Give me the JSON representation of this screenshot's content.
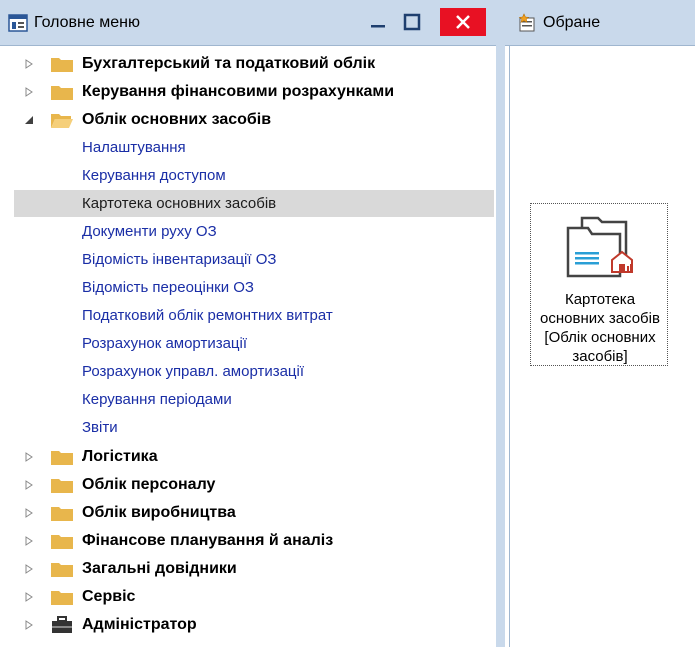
{
  "main_menu": {
    "title": "Головне меню",
    "categories_top": [
      {
        "label": "Бухгалтерський та податковий облік",
        "expanded": false
      },
      {
        "label": "Керування фінансовими розрахунками",
        "expanded": false
      },
      {
        "label": "Облік основних засобів",
        "expanded": true
      }
    ],
    "subitems": [
      {
        "label": "Налаштування",
        "selected": false
      },
      {
        "label": "Керування доступом",
        "selected": false
      },
      {
        "label": "Картотека основних засобів",
        "selected": true
      },
      {
        "label": "Документи руху ОЗ",
        "selected": false
      },
      {
        "label": "Відомість інвентаризації ОЗ",
        "selected": false
      },
      {
        "label": "Відомість переоцінки ОЗ",
        "selected": false
      },
      {
        "label": "Податковий облік ремонтних витрат",
        "selected": false
      },
      {
        "label": "Розрахунок амортизації",
        "selected": false
      },
      {
        "label": "Розрахунок управл. амортизації",
        "selected": false
      },
      {
        "label": "Керування періодами",
        "selected": false
      },
      {
        "label": "Звіти",
        "selected": false
      }
    ],
    "categories_bottom": [
      {
        "label": "Логістика",
        "icon": "folder-icon"
      },
      {
        "label": "Облік персоналу",
        "icon": "folder-icon"
      },
      {
        "label": "Облік виробництва",
        "icon": "folder-icon"
      },
      {
        "label": "Фінансове планування й аналіз",
        "icon": "folder-icon"
      },
      {
        "label": "Загальні довідники",
        "icon": "folder-icon"
      },
      {
        "label": "Сервіс",
        "icon": "folder-icon"
      },
      {
        "label": "Адміністратор",
        "icon": "toolbox-icon"
      }
    ]
  },
  "favorites": {
    "title": "Обране",
    "tile": {
      "line1": "Картотека",
      "line2": "основних засобів",
      "line3": "[Облік основних",
      "line4": "засобів]"
    }
  },
  "colors": {
    "titlebar": "#c9d9eb",
    "link": "#1a2ea6",
    "close": "#e81123",
    "folder": "#e8b64c",
    "selected_row": "#d9d9d9"
  }
}
